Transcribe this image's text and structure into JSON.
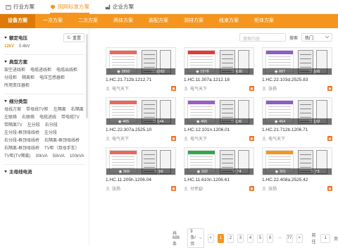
{
  "top_tabs": [
    {
      "label": "行业方案",
      "icon": "building-icon"
    },
    {
      "label": "国网标准方案",
      "icon": "shield-icon"
    },
    {
      "label": "企业方案",
      "icon": "factory-icon"
    }
  ],
  "sub_tabs": [
    "设备方案",
    "一次方案",
    "二次方案",
    "两体方案",
    "装配方案",
    "测排方案",
    "线束方案",
    "柜体方案"
  ],
  "sidebar": {
    "reset_label": "重置",
    "sections": [
      {
        "title": "额定电压",
        "options": [
          "12kV",
          "0.4kV"
        ],
        "selected": 0
      },
      {
        "title": "典型方案",
        "options": [
          "架空进线柜",
          "电缆进线柜",
          "电缆出线柜",
          "分段柜",
          "隔离柜",
          "电压互感器柜",
          "所用变压器柜"
        ]
      },
      {
        "title": "细分类型",
        "options": [
          "母线方案",
          "带母线TV柜",
          "左隔离",
          "右隔离",
          "左联络",
          "右联络",
          "电缆进线",
          "带电缆TV",
          "带隔离TV",
          "左分段",
          "右分段",
          "左分段-框顶母线桥",
          "左分段",
          "右分段-框顶母线桥",
          "右隔离-框顶母线桥",
          "右隔离-框顶母线桥",
          "TV柜（双母手车）",
          "TV柜(TV隔离)",
          "30kVA",
          "50kVA",
          "100kVA"
        ]
      },
      {
        "title": "主母线电流",
        "options": []
      }
    ]
  },
  "toolbar": {
    "search_placeholder": "搜索内容",
    "search_label": "搜索",
    "sort_value": "热门"
  },
  "cards": [
    {
      "title": "1.HC.21.712b.1212.71",
      "author": "电气天下",
      "views": "3892",
      "likes": "2282",
      "head_color": "#e8685c"
    },
    {
      "title": "1.HC.11.307a.1212.18",
      "author": "电气天下",
      "views": "1578",
      "likes": "630",
      "head_color": "#e53935"
    },
    {
      "title": "1.HC.22.103d.2525.83",
      "author": "张扬",
      "views": "887",
      "likes": "166",
      "head_color": "#8e5bc7"
    },
    {
      "title": "1.HC.22.307a.2525.10",
      "author": "电气天下",
      "views": "465",
      "likes": "144",
      "head_color": "#e8685c"
    },
    {
      "title": "1.HC.12.101n.1206.01",
      "author": "电气天下",
      "views": "465",
      "likes": "136",
      "head_color": "#9c5cc9"
    },
    {
      "title": "1.HC.21.712b.1206.71",
      "author": "电气天下",
      "views": "464",
      "likes": "132",
      "head_color": "#8e5bc7"
    },
    {
      "title": "1.HC.11.205h.1206.04",
      "author": "张扬",
      "views": "369",
      "likes": "80",
      "head_color": "#e8685c"
    },
    {
      "title": "1.HC.11.610n.1206.61",
      "author": "付怀勐",
      "views": "332",
      "likes": "74",
      "head_color": "#31a84c"
    },
    {
      "title": "1.HC.22.408a.2525.42",
      "author": "张扬",
      "views": "301",
      "likes": "73",
      "head_color": "#f5951d"
    }
  ],
  "pagination": {
    "total": "共 686 条",
    "page_size": "9条/页",
    "pages": [
      "1",
      "2",
      "3",
      "4",
      "5",
      "6",
      "...",
      "77"
    ],
    "active": "1",
    "prev": "<",
    "next": ">",
    "goto_label": "前往",
    "goto_value": "1",
    "page_suffix": "页"
  },
  "colors": {
    "accent": "#f5951d"
  }
}
